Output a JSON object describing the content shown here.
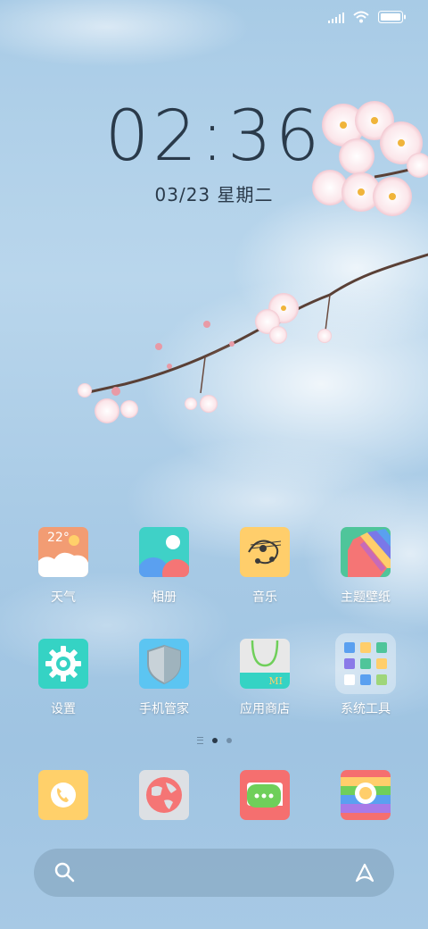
{
  "status_bar": {
    "icons": [
      "signal-icon",
      "wifi-icon",
      "battery-icon"
    ]
  },
  "lockscreen": {
    "time": "02:36",
    "date": "03/23 星期二"
  },
  "apps": [
    {
      "label": "天气",
      "icon": "weather-icon",
      "badge": "22°"
    },
    {
      "label": "相册",
      "icon": "gallery-icon"
    },
    {
      "label": "音乐",
      "icon": "music-icon"
    },
    {
      "label": "主题壁纸",
      "icon": "themes-icon"
    },
    {
      "label": "设置",
      "icon": "settings-gear-icon"
    },
    {
      "label": "手机管家",
      "icon": "security-shield-icon"
    },
    {
      "label": "应用商店",
      "icon": "app-store-bag-icon",
      "badge": "MI"
    },
    {
      "label": "系统工具",
      "icon": "folder-icon"
    }
  ],
  "dock": [
    {
      "icon": "phone-icon"
    },
    {
      "icon": "browser-globe-icon"
    },
    {
      "icon": "messages-icon"
    },
    {
      "icon": "camera-icon"
    }
  ],
  "page_indicator": {
    "pages": 2,
    "active": 0
  },
  "search_bar": {
    "icons": [
      "search-icon",
      "assistant-icon"
    ]
  },
  "colors": {
    "weather": "#f29c73",
    "gallery": "#3fd1c7",
    "music": "#ffce6b",
    "themes": "#4fc59a",
    "settings": "#35d3c4",
    "security": "#5cc5f2",
    "store": "#e8e8e8",
    "phone": "#ffd06a",
    "browser": "#dde0e4",
    "messages": "#f56f6f",
    "camera": "#f56f6f"
  }
}
